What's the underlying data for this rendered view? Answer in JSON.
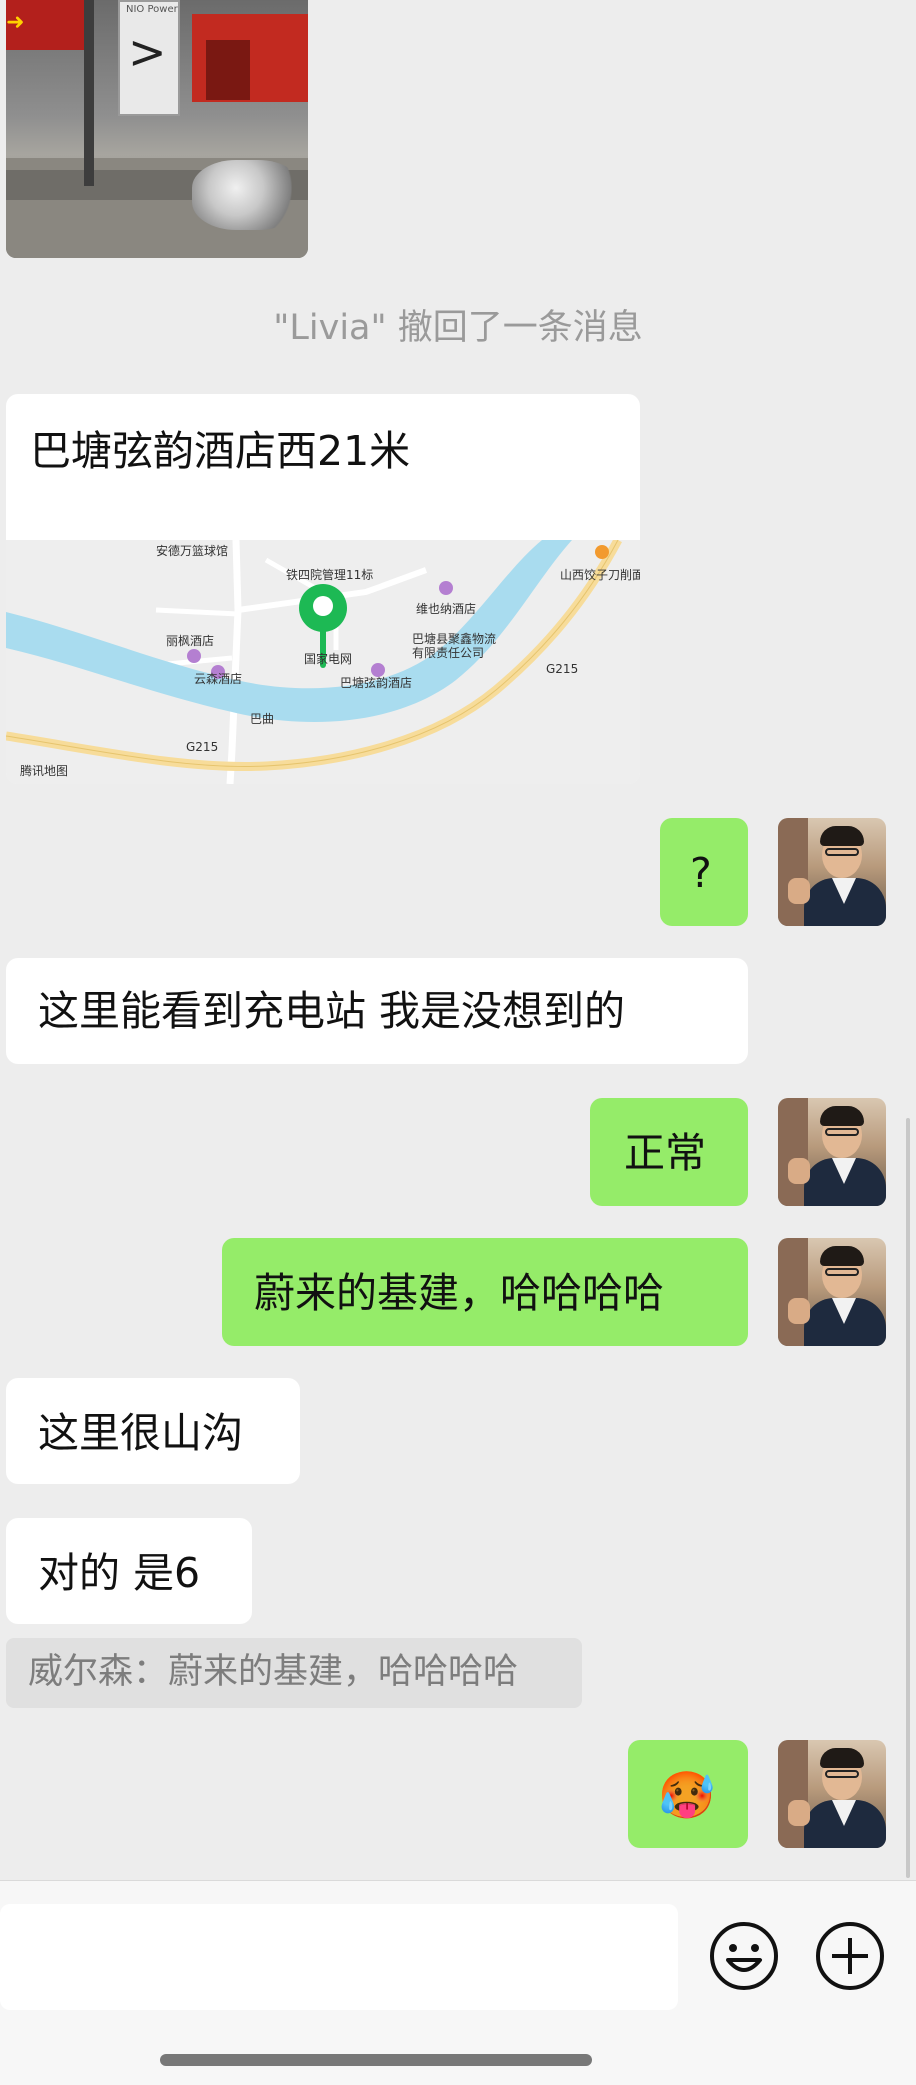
{
  "chat": {
    "recall_notice": "\"Livia\" 撤回了一条消息",
    "location": {
      "title": "巴塘弦韵酒店西21米",
      "map_labels": {
        "sports": "安德万篮球馆",
        "station": "铁四院管理11标",
        "shanxi": "山西饺子刀削面",
        "weiye": "维也纳酒店",
        "lifeng": "丽枫酒店",
        "grid": "国家电网",
        "logistics_1": "巴塘县聚鑫物流",
        "logistics_2": "有限责任公司",
        "yunsen": "云森酒店",
        "xianyun": "巴塘弦韵酒店",
        "river": "巴曲",
        "road_1": "G215",
        "road_2": "G215",
        "provider": "腾讯地图"
      }
    },
    "messages": {
      "out_question": "?",
      "in_charging": "这里能看到充电站 我是没想到的",
      "out_normal": "正常",
      "out_nio": "蔚来的基建，哈哈哈哈",
      "in_mountain": "这里很山沟",
      "in_right": "对的 是6",
      "quote": "威尔森：蔚来的基建，哈哈哈哈",
      "out_emoji": "🥵"
    }
  },
  "photo": {
    "brand_text": "NIO Power"
  },
  "input": {
    "emoji_icon": "smiley-face-icon",
    "add_icon": "plus-circle-icon"
  },
  "colors": {
    "background": "#ededed",
    "incoming_bubble": "#ffffff",
    "outgoing_bubble": "#95ec69",
    "map_water": "#a9dcef",
    "map_road": "#f7dc9a",
    "pin": "#1db954"
  }
}
